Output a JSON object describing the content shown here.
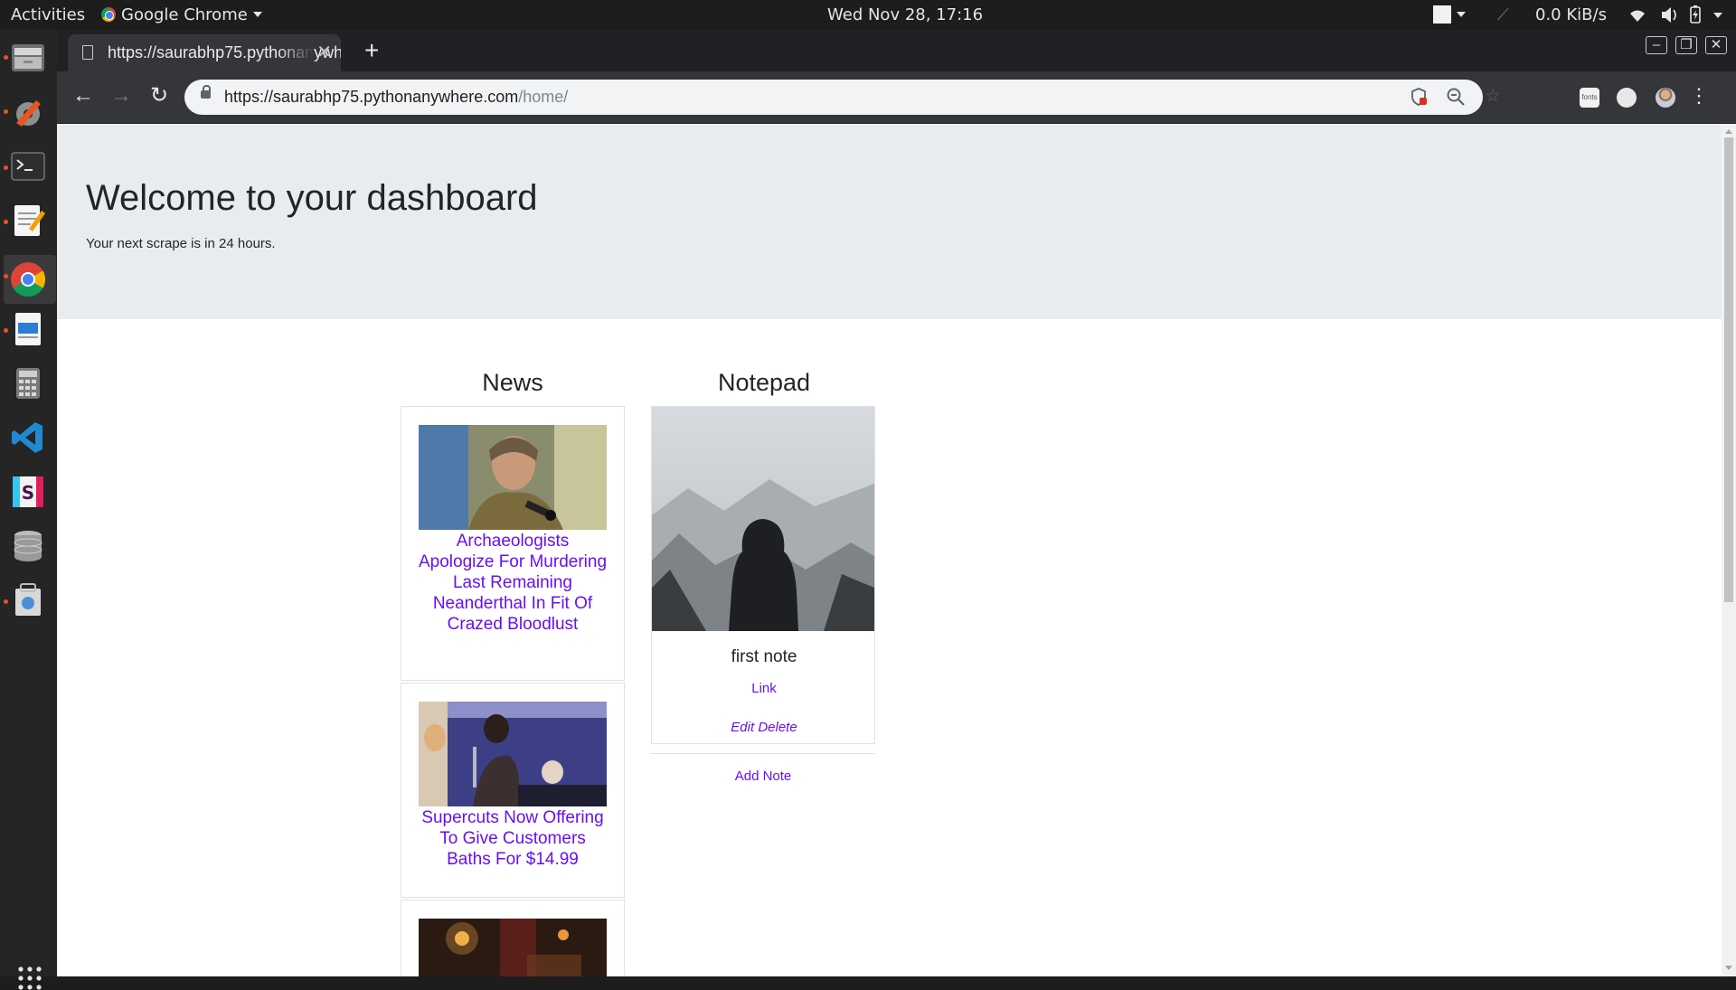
{
  "topbar": {
    "activities": "Activities",
    "app_menu": "Google Chrome",
    "clock": "Wed Nov 28, 17:16",
    "net_speed": "0.0 KiB/s"
  },
  "dock": {
    "items": [
      "files-icon",
      "settings-icon",
      "terminal-icon",
      "text-editor-icon",
      "chrome-icon",
      "writer-icon",
      "calculator-icon",
      "vscode-icon",
      "slack-icon",
      "database-icon",
      "archive-icon"
    ]
  },
  "browser": {
    "tab_title": "https://saurabhp75.pythonanywhere.com/home/",
    "url_host": "https://saurabhp75.pythonanywhere.com",
    "url_path": "/home/",
    "ext_fonts_label": "fonts"
  },
  "page": {
    "heading": "Welcome to your dashboard",
    "subtitle": "Your next scrape is in 24 hours.",
    "news": {
      "title": "News",
      "items": [
        {
          "headline": "Archaeologists Apologize For Murdering Last Remaining Neanderthal In Fit Of Crazed Bloodlust"
        },
        {
          "headline": "Supercuts Now Offering To Give Customers Baths For $14.99"
        }
      ]
    },
    "notepad": {
      "title": "Notepad",
      "note_title": "first note",
      "note_link": "Link",
      "edit_label": "Edit",
      "delete_label": "Delete",
      "add_note": "Add Note"
    }
  },
  "colors": {
    "link": "#6610f2",
    "jumbotron": "#e9ecef",
    "ubuntu_orange": "#e95420"
  }
}
